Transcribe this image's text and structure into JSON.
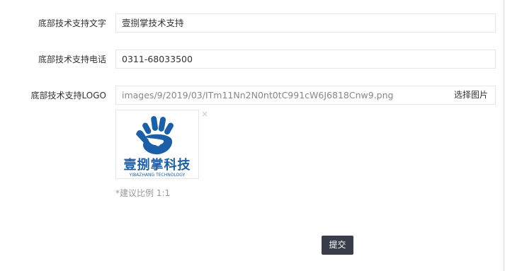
{
  "form": {
    "support_text": {
      "label": "底部技术支持文字",
      "value": "壹捌掌技术支持"
    },
    "support_phone": {
      "label": "底部技术支持电话",
      "value": "0311-68033500"
    },
    "support_logo": {
      "label": "底部技术支持LOGO",
      "path": "images/9/2019/03/ITm11Nn2N0nt0tC991cW6J6818Cnw9.png",
      "pick_button": "选择图片",
      "remove_icon": "×",
      "hint": "*建议比例 1:1",
      "logo_text_cn": "壹捌掌科技",
      "logo_text_en": "YIBAZHANG TECHNOLOGY",
      "logo_color": "#1a5fa8"
    },
    "submit_label": "提交"
  }
}
